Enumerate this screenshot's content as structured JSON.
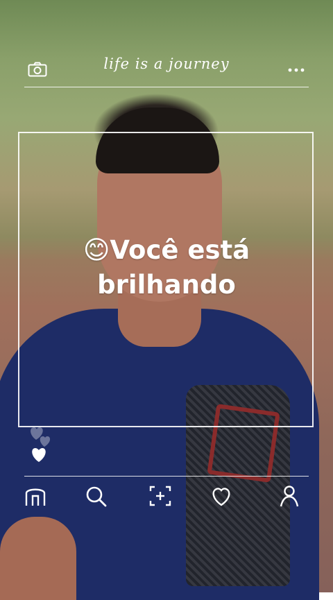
{
  "header": {
    "tagline": "life is a journey",
    "camera_icon": "camera-icon",
    "more_icon": "more-dots-icon"
  },
  "caption": {
    "line1": "😊Você está",
    "line2": "brilhando"
  },
  "reaction_icons": [
    "heart-faint-icon",
    "heart-faint-icon",
    "heart-filled-icon"
  ],
  "bottom_nav": {
    "items": [
      {
        "icon": "home-icon"
      },
      {
        "icon": "search-icon"
      },
      {
        "icon": "add-post-icon"
      },
      {
        "icon": "heart-icon"
      },
      {
        "icon": "profile-icon"
      }
    ]
  },
  "colors": {
    "overlay": "#ffffff"
  }
}
